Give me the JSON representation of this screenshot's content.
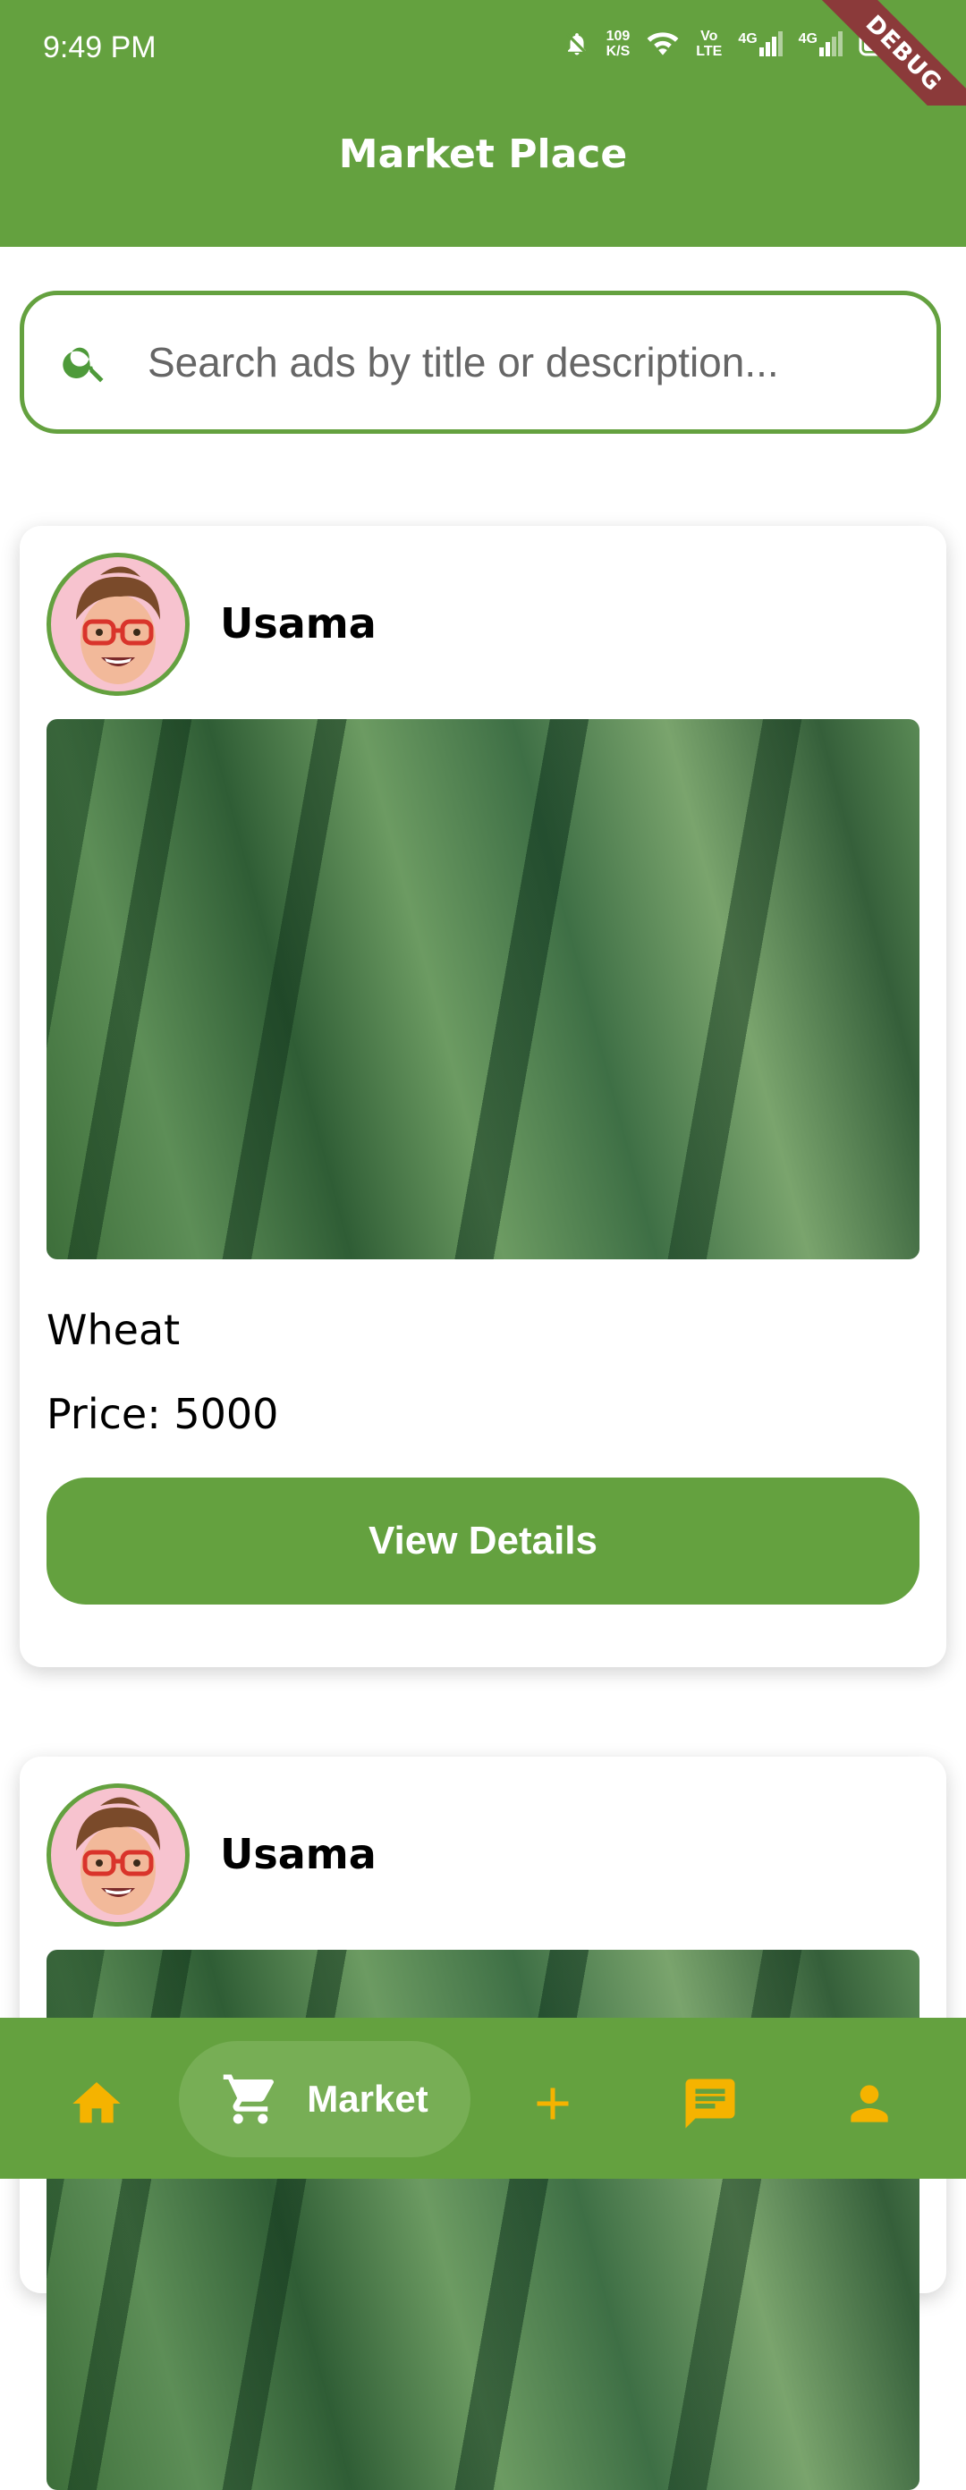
{
  "status_bar": {
    "time": "9:49 PM",
    "network_speed_top": "109",
    "network_speed_bottom": "K/S",
    "volte_top": "Vo",
    "volte_bottom": "LTE",
    "signal1_label": "4G",
    "signal2_label": "4G",
    "debug_label": "DEBUG"
  },
  "app_bar": {
    "title": "Market Place"
  },
  "search": {
    "placeholder": "Search ads by title or description..."
  },
  "listings": [
    {
      "username": "Usama",
      "title": "Wheat",
      "price": "Price: 5000",
      "button_label": "View Details"
    },
    {
      "username": "Usama"
    }
  ],
  "bottom_nav": {
    "active_label": "Market",
    "icons": [
      "home-icon",
      "cart-icon",
      "add-icon",
      "chat-icon",
      "person-icon"
    ]
  },
  "colors": {
    "primary": "#64a13f",
    "accent_icon": "#f5b300",
    "avatar_bg": "#f7c3cf"
  }
}
